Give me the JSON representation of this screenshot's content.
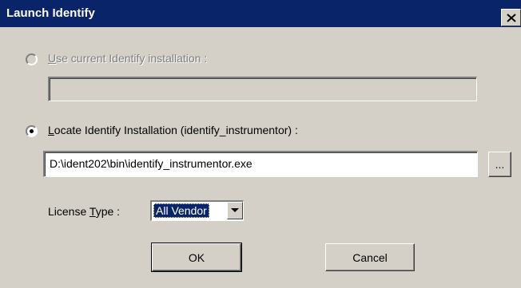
{
  "window": {
    "title": "Launch Identify",
    "close_icon": "close-icon"
  },
  "option_current": {
    "label_hotkey": "U",
    "label_rest": "se current Identify installation :",
    "value": "",
    "selected": false,
    "enabled": false
  },
  "option_locate": {
    "label_hotkey": "L",
    "label_rest": "ocate Identify Installation (identify_instrumentor) :",
    "value": "D:\\ident202\\bin\\identify_instrumentor.exe",
    "selected": true,
    "enabled": true
  },
  "browse": {
    "label": "..."
  },
  "license": {
    "label_before": "License ",
    "label_hotkey": "T",
    "label_after": "ype :",
    "selected": "All Vendor",
    "arrow_icon": "chevron-down-icon"
  },
  "buttons": {
    "ok": "OK",
    "cancel": "Cancel"
  }
}
